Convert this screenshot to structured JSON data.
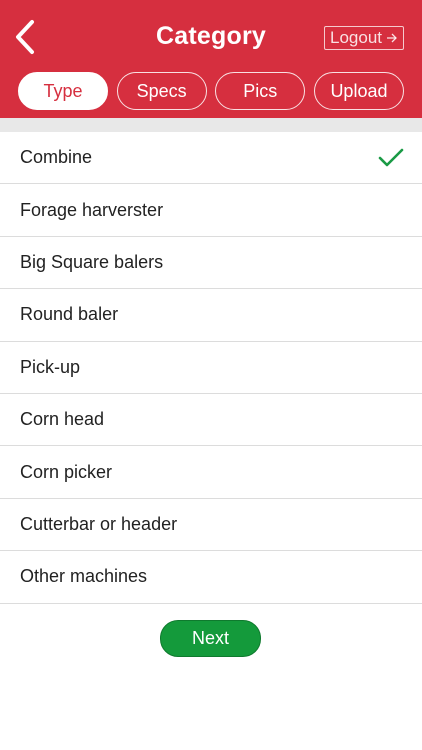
{
  "header": {
    "title": "Category",
    "logout_label": "Logout",
    "back_icon": "chevron-left-icon",
    "logout_icon": "arrow-right-icon"
  },
  "tabs": [
    {
      "label": "Type",
      "active": true
    },
    {
      "label": "Specs",
      "active": false
    },
    {
      "label": "Pics",
      "active": false
    },
    {
      "label": "Upload",
      "active": false
    }
  ],
  "categories": [
    {
      "label": "Combine",
      "selected": true
    },
    {
      "label": "Forage harverster",
      "selected": false
    },
    {
      "label": "Big Square balers",
      "selected": false
    },
    {
      "label": "Round baler",
      "selected": false
    },
    {
      "label": "Pick-up",
      "selected": false
    },
    {
      "label": "Corn head",
      "selected": false
    },
    {
      "label": "Corn picker",
      "selected": false
    },
    {
      "label": "Cutterbar or header",
      "selected": false
    },
    {
      "label": "Other machines",
      "selected": false
    }
  ],
  "next_label": "Next",
  "colors": {
    "header_bg": "#d62f3f",
    "accent_green": "#149a3b",
    "check_green": "#1a9a45"
  }
}
